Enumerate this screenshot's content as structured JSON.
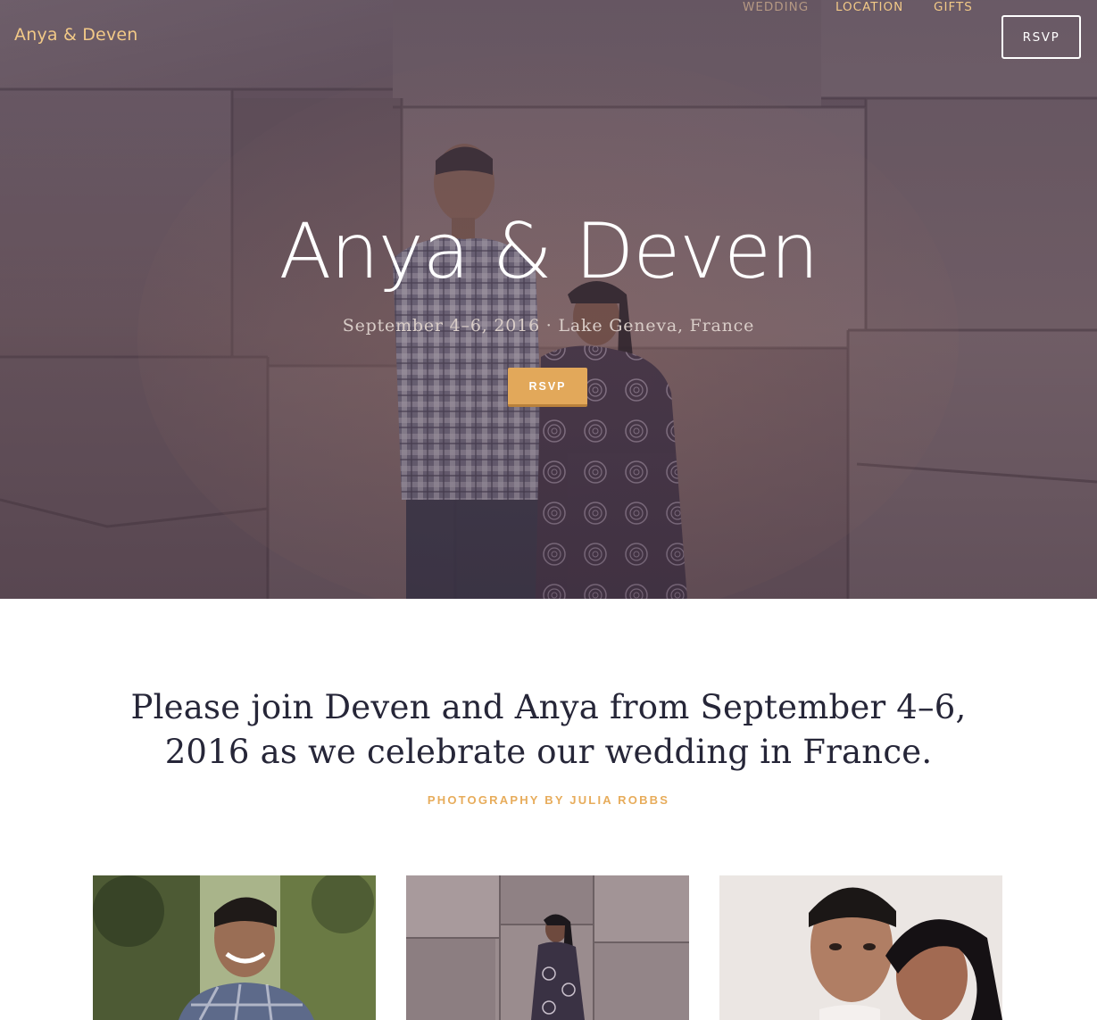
{
  "nav": {
    "brand": "Anya & Deven",
    "links": [
      {
        "label": "WEDDING"
      },
      {
        "label": "LOCATION"
      },
      {
        "label": "GIFTS"
      }
    ],
    "rsvp_label": "RSVP"
  },
  "hero": {
    "title": "Anya & Deven",
    "subtitle": "September 4–6, 2016 · Lake Geneva, France",
    "rsvp_label": "RSVP"
  },
  "intro": {
    "text": "Please join Deven and Anya from September 4–6, 2016 as we celebrate our wedding in France.",
    "credit": "PHOTOGRAPHY BY JULIA ROBBS"
  },
  "colors": {
    "accent_gold": "#e2a85a",
    "nav_gold": "#f2c987",
    "nav_muted": "#b59883",
    "text_dark": "#262638"
  }
}
